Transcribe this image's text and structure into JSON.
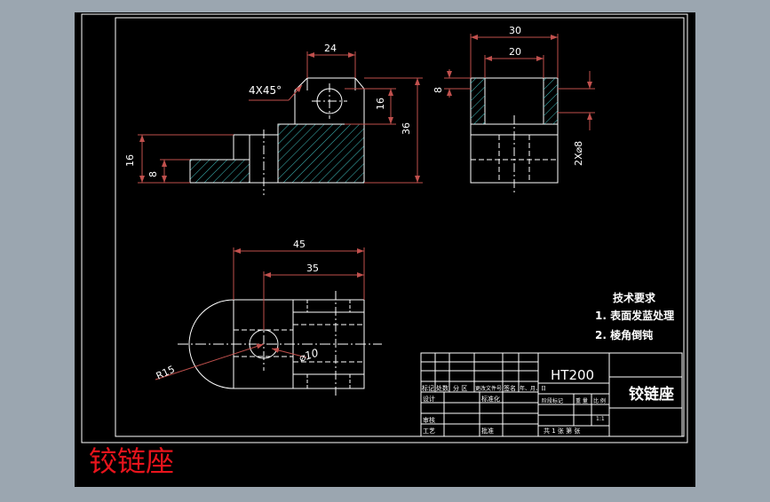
{
  "drawing": {
    "caption": "铰链座",
    "colors": {
      "background": "#000000",
      "surround": "#9ba6b0",
      "line": "#ffffff",
      "dimension": "#c0504d",
      "hatch": "#3fbfbf",
      "caption": "#e8141c"
    },
    "front_view": {
      "dim_top_width": "24",
      "chamfer_note": "4X45°",
      "dim_hole_height": "16",
      "dim_total_height": "36",
      "dim_left_height": "16",
      "dim_left_inner": "8"
    },
    "side_view": {
      "dim_outer_width": "30",
      "dim_inner_width": "20",
      "dim_step": "8",
      "dim_holes": "2X⌀8"
    },
    "top_view": {
      "dim_length_total": "45",
      "dim_length_center": "35",
      "dim_radius": "R15",
      "dim_hole_dia": "⌀10"
    },
    "tech_requirements": {
      "heading": "技术要求",
      "item_1": "1. 表面发蓝处理",
      "item_2": "2. 棱角倒钝"
    },
    "title_block": {
      "material": "HT200",
      "part_name": "铰链座",
      "hdr_mark": "标记",
      "hdr_count": "处数",
      "hdr_zone": "分 区",
      "hdr_docno": "更改文件号",
      "hdr_sign": "签名",
      "hdr_date": "年、月、日",
      "row_design": "设计",
      "row_standard": "标准化",
      "row_check": "审核",
      "row_process": "工艺",
      "row_approve": "批准",
      "stage_mark": "阶段标记",
      "weight": "重 量",
      "scale_label": "比 例",
      "scale_value": "1:1",
      "sheets": "共 1 张  第  张"
    }
  }
}
